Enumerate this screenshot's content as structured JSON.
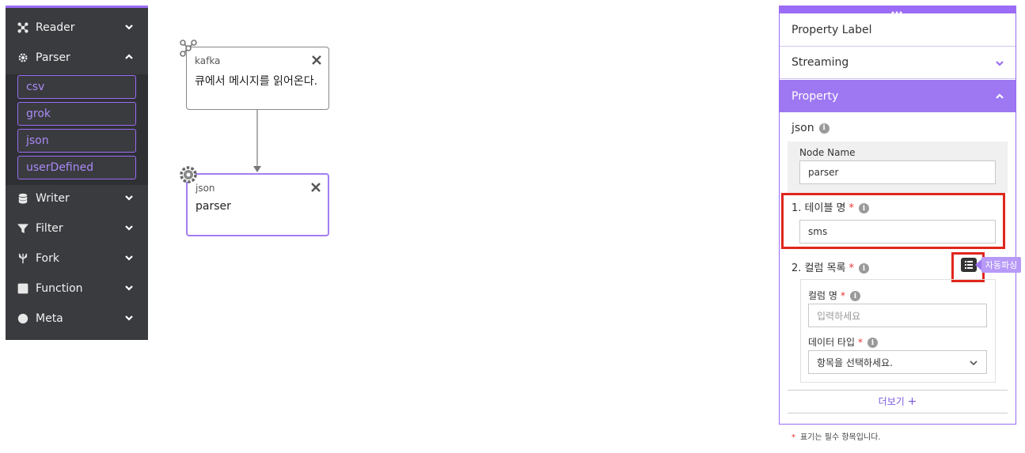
{
  "sidebar": {
    "items": [
      {
        "label": "Reader",
        "icon": "network-icon",
        "expanded": false
      },
      {
        "label": "Parser",
        "icon": "gear-icon",
        "expanded": true
      },
      {
        "label": "Writer",
        "icon": "database-icon",
        "expanded": false
      },
      {
        "label": "Filter",
        "icon": "funnel-icon",
        "expanded": false
      },
      {
        "label": "Fork",
        "icon": "fork-icon",
        "expanded": false
      },
      {
        "label": "Function",
        "icon": "terminal-icon",
        "expanded": false
      },
      {
        "label": "Meta",
        "icon": "globe-icon",
        "expanded": false
      }
    ],
    "parser_subitems": [
      "csv",
      "grok",
      "json",
      "userDefined"
    ]
  },
  "canvas": {
    "nodes": [
      {
        "type": "kafka",
        "description": "큐에서 메시지를 읽어온다.",
        "icon": "network-icon"
      },
      {
        "type": "json",
        "description": "parser",
        "icon": "gear-icon"
      }
    ]
  },
  "panel": {
    "property_label": "Property Label",
    "streaming": "Streaming",
    "property": "Property",
    "section_name": "json",
    "node_name_label": "Node Name",
    "node_name_value": "parser",
    "table_name_label": "1. 테이블 명",
    "table_name_value": "sms",
    "column_list_label": "2. 컬럼 목록",
    "auto_parse_tooltip": "자동파싱",
    "column_name_label": "컬럼 명",
    "column_name_placeholder": "입력하세요",
    "data_type_label": "데이터 타입",
    "data_type_value": "항목을 선택하세요.",
    "more_label": "더보기",
    "required_note": "표기는 필수 항목입니다.",
    "required_star": "*"
  },
  "colors": {
    "accent": "#9b6cf5",
    "sidebar_bg": "#3a3b3f",
    "highlight": "#e0261c"
  }
}
